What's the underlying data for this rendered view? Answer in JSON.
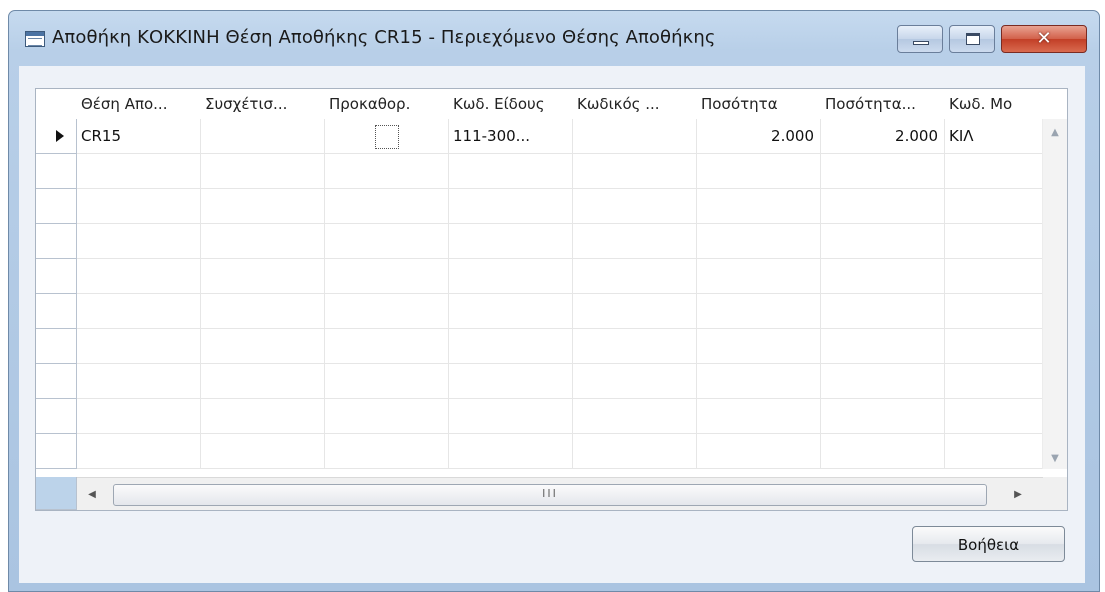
{
  "window": {
    "title": "Αποθήκη ΚΟΚΚΙΝΗ Θέση Αποθήκης CR15 - Περιεχόμενο Θέσης Αποθήκης",
    "icon": "table-form-icon",
    "controls": {
      "minimize": "minimize-icon",
      "maximize": "maximize-icon",
      "close": "✕"
    }
  },
  "table": {
    "columns": [
      "Θέση Απο...",
      "Συσχέτισ...",
      "Προκαθορ.",
      "Κωδ. Είδους",
      "Κωδικός ...",
      "Ποσότητα",
      "Ποσότητα...",
      "Κωδ. Μο"
    ],
    "rows": [
      {
        "bin": "CR15",
        "association": "",
        "default": false,
        "item_no": "111-300...",
        "code": "",
        "quantity": "2.000",
        "quantity_base": "2.000",
        "uom": "ΚΙΛ"
      }
    ],
    "empty_rows": 9,
    "hscroll_thumb": "III"
  },
  "footer": {
    "help_label": "Βοήθεια"
  }
}
